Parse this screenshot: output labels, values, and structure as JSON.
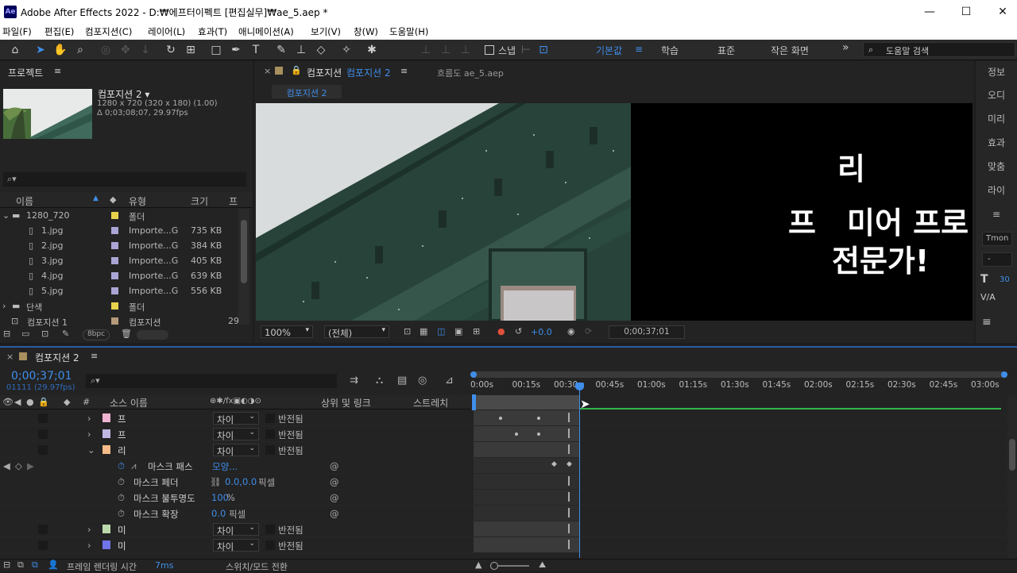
{
  "window": {
    "title": "Adobe After Effects 2022 - D:₩에프터이펙트 [편집실무]₩ae_5.aep *",
    "logo": "Ae",
    "min": "—",
    "max": "☐",
    "close": "✕"
  },
  "menu": [
    "파일(F)",
    "편집(E)",
    "컴포지션(C)",
    "레이어(L)",
    "효과(T)",
    "애니메이션(A)",
    "보기(V)",
    "창(W)",
    "도움말(H)"
  ],
  "toolbar": {
    "snap_label": "스냅",
    "workspaces": [
      "기본값",
      "학습",
      "표준",
      "작은 화면"
    ],
    "more": "»",
    "help_search": "도움말 검색"
  },
  "project": {
    "title": "프로젝트",
    "comp_name": "컴포지션 2 ▾",
    "comp_info1": "1280 x 720  (320 x 180) (1.00)",
    "comp_info2": "Δ 0;03;08;07, 29.97fps",
    "search_placeholder": "",
    "columns": [
      "이름",
      "유형",
      "크기",
      "프"
    ],
    "items": [
      {
        "name": "1280_720",
        "type": "폴더",
        "size": "",
        "color": "#e8d24c",
        "kind": "folder",
        "expanded": true
      },
      {
        "name": "1.jpg",
        "type": "Importe...G",
        "size": "735 KB",
        "color": "#a9a5d4",
        "kind": "file"
      },
      {
        "name": "2.jpg",
        "type": "Importe...G",
        "size": "384 KB",
        "color": "#a9a5d4",
        "kind": "file"
      },
      {
        "name": "3.jpg",
        "type": "Importe...G",
        "size": "405 KB",
        "color": "#a9a5d4",
        "kind": "file"
      },
      {
        "name": "4.jpg",
        "type": "Importe...G",
        "size": "639 KB",
        "color": "#a9a5d4",
        "kind": "file"
      },
      {
        "name": "5.jpg",
        "type": "Importe...G",
        "size": "556 KB",
        "color": "#a9a5d4",
        "kind": "file"
      },
      {
        "name": "단색",
        "type": "폴더",
        "size": "",
        "color": "#e8d24c",
        "kind": "folder",
        "expanded": false
      },
      {
        "name": "컴포지션 1",
        "type": "컴포지션",
        "size": "29",
        "color": "#b59a7a",
        "kind": "comp"
      }
    ],
    "bpc": "8bpc"
  },
  "viewer": {
    "tab_label": "컴포지션",
    "tab_comp": "컴포지션 2",
    "flow_tab": "흐름도 ae_5.aep",
    "crumb": "컴포지션 2",
    "text_line1": "리",
    "text_line2a": "프",
    "text_line2b": "미어 프로",
    "text_line3": "전문가!",
    "zoom": "100%",
    "resolution": "(전체)",
    "exposure": "+0.0",
    "timecode": "0;00;37;01"
  },
  "right_tabs": [
    "정보",
    "오디",
    "미리",
    "효과",
    "맞춤",
    "라이",
    "≡"
  ],
  "char_panel": {
    "font": "Tmon",
    "style": "-",
    "size": "30"
  },
  "timeline": {
    "tab": "컴포지션 2",
    "timecode": "0;00;37;01",
    "frames": "01111 (29.97fps)",
    "col_src": "소스 이름",
    "col_parent": "상위 및 링크",
    "col_stretch": "스트레치",
    "ruler": [
      "0:00s",
      "00:15s",
      "00:30s",
      "00:45s",
      "01:00s",
      "01:15s",
      "01:30s",
      "01:45s",
      "02:00s",
      "02:15s",
      "02:30s",
      "02:45s",
      "03:00s"
    ],
    "layers": [
      {
        "name": "프",
        "mode": "차이",
        "invert": "반전됨",
        "color": "#f0b4d2",
        "open": false
      },
      {
        "name": "프",
        "mode": "차이",
        "invert": "반전됨",
        "color": "#c0b7e0",
        "open": false
      },
      {
        "name": "리",
        "mode": "차이",
        "invert": "반전됨",
        "color": "#f5bb88",
        "open": true
      },
      {
        "name": "미",
        "mode": "차이",
        "invert": "반전됨",
        "color": "#bcd9ac",
        "open": false
      },
      {
        "name": "미",
        "mode": "차이",
        "invert": "반전됨",
        "color": "#6f74e8",
        "open": false
      }
    ],
    "mask_props": [
      {
        "name": "마스크 패스",
        "value": "모양...",
        "unit": ""
      },
      {
        "name": "마스크 페더",
        "value": "0.0,0.0",
        "unit": "픽셀"
      },
      {
        "name": "마스크 불투명도",
        "value": "100",
        "unit": "%"
      },
      {
        "name": "마스크 확장",
        "value": "0.0",
        "unit": "픽셀"
      }
    ],
    "footer_label": "프레임 렌더링 시간",
    "footer_ms": "7ms",
    "footer_toggle": "스위치/모드 전환"
  }
}
